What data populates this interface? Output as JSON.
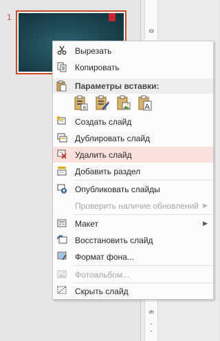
{
  "thumbnail_pane": {
    "slide_number": "1"
  },
  "ruler": {
    "numbers": [
      "0",
      "6"
    ]
  },
  "context_menu": {
    "items": [
      {
        "label": "Вырезать",
        "icon": "scissors-icon",
        "enabled": true
      },
      {
        "label": "Копировать",
        "icon": "copy-icon",
        "enabled": true
      },
      {
        "label": "Параметры вставки:",
        "icon": "paste-icon",
        "enabled": true,
        "header": true
      },
      {
        "label": "Создать слайд",
        "icon": "new-slide-icon",
        "enabled": true
      },
      {
        "label": "Дублировать слайд",
        "icon": "duplicate-slide-icon",
        "enabled": true
      },
      {
        "label": "Удалить слайд",
        "icon": "delete-slide-icon",
        "enabled": true,
        "highlighted": true
      },
      {
        "label": "Добавить раздел",
        "icon": "add-section-icon",
        "enabled": true
      },
      {
        "label": "Опубликовать слайды",
        "icon": "publish-slides-icon",
        "enabled": true
      },
      {
        "label": "Проверить наличие обновлений",
        "icon": "",
        "enabled": false,
        "submenu": true
      },
      {
        "label": "Макет",
        "icon": "layout-icon",
        "enabled": true,
        "submenu": true
      },
      {
        "label": "Восстановить слайд",
        "icon": "reset-slide-icon",
        "enabled": true
      },
      {
        "label": "Формат фона...",
        "icon": "format-background-icon",
        "enabled": true
      },
      {
        "label": "Фотоальбом...",
        "icon": "photo-album-icon",
        "enabled": false
      },
      {
        "label": "Скрыть слайд",
        "icon": "hide-slide-icon",
        "enabled": true
      }
    ],
    "paste_options": [
      {
        "name": "use-destination-theme-icon",
        "letter": "a"
      },
      {
        "name": "keep-source-formatting-icon",
        "letter": ""
      },
      {
        "name": "picture-icon",
        "letter": ""
      },
      {
        "name": "keep-text-only-icon",
        "letter": "A"
      }
    ]
  },
  "colors": {
    "accent": "#d24726",
    "highlight": "#fbe1dc",
    "disabled_text": "#a6a6a6"
  }
}
